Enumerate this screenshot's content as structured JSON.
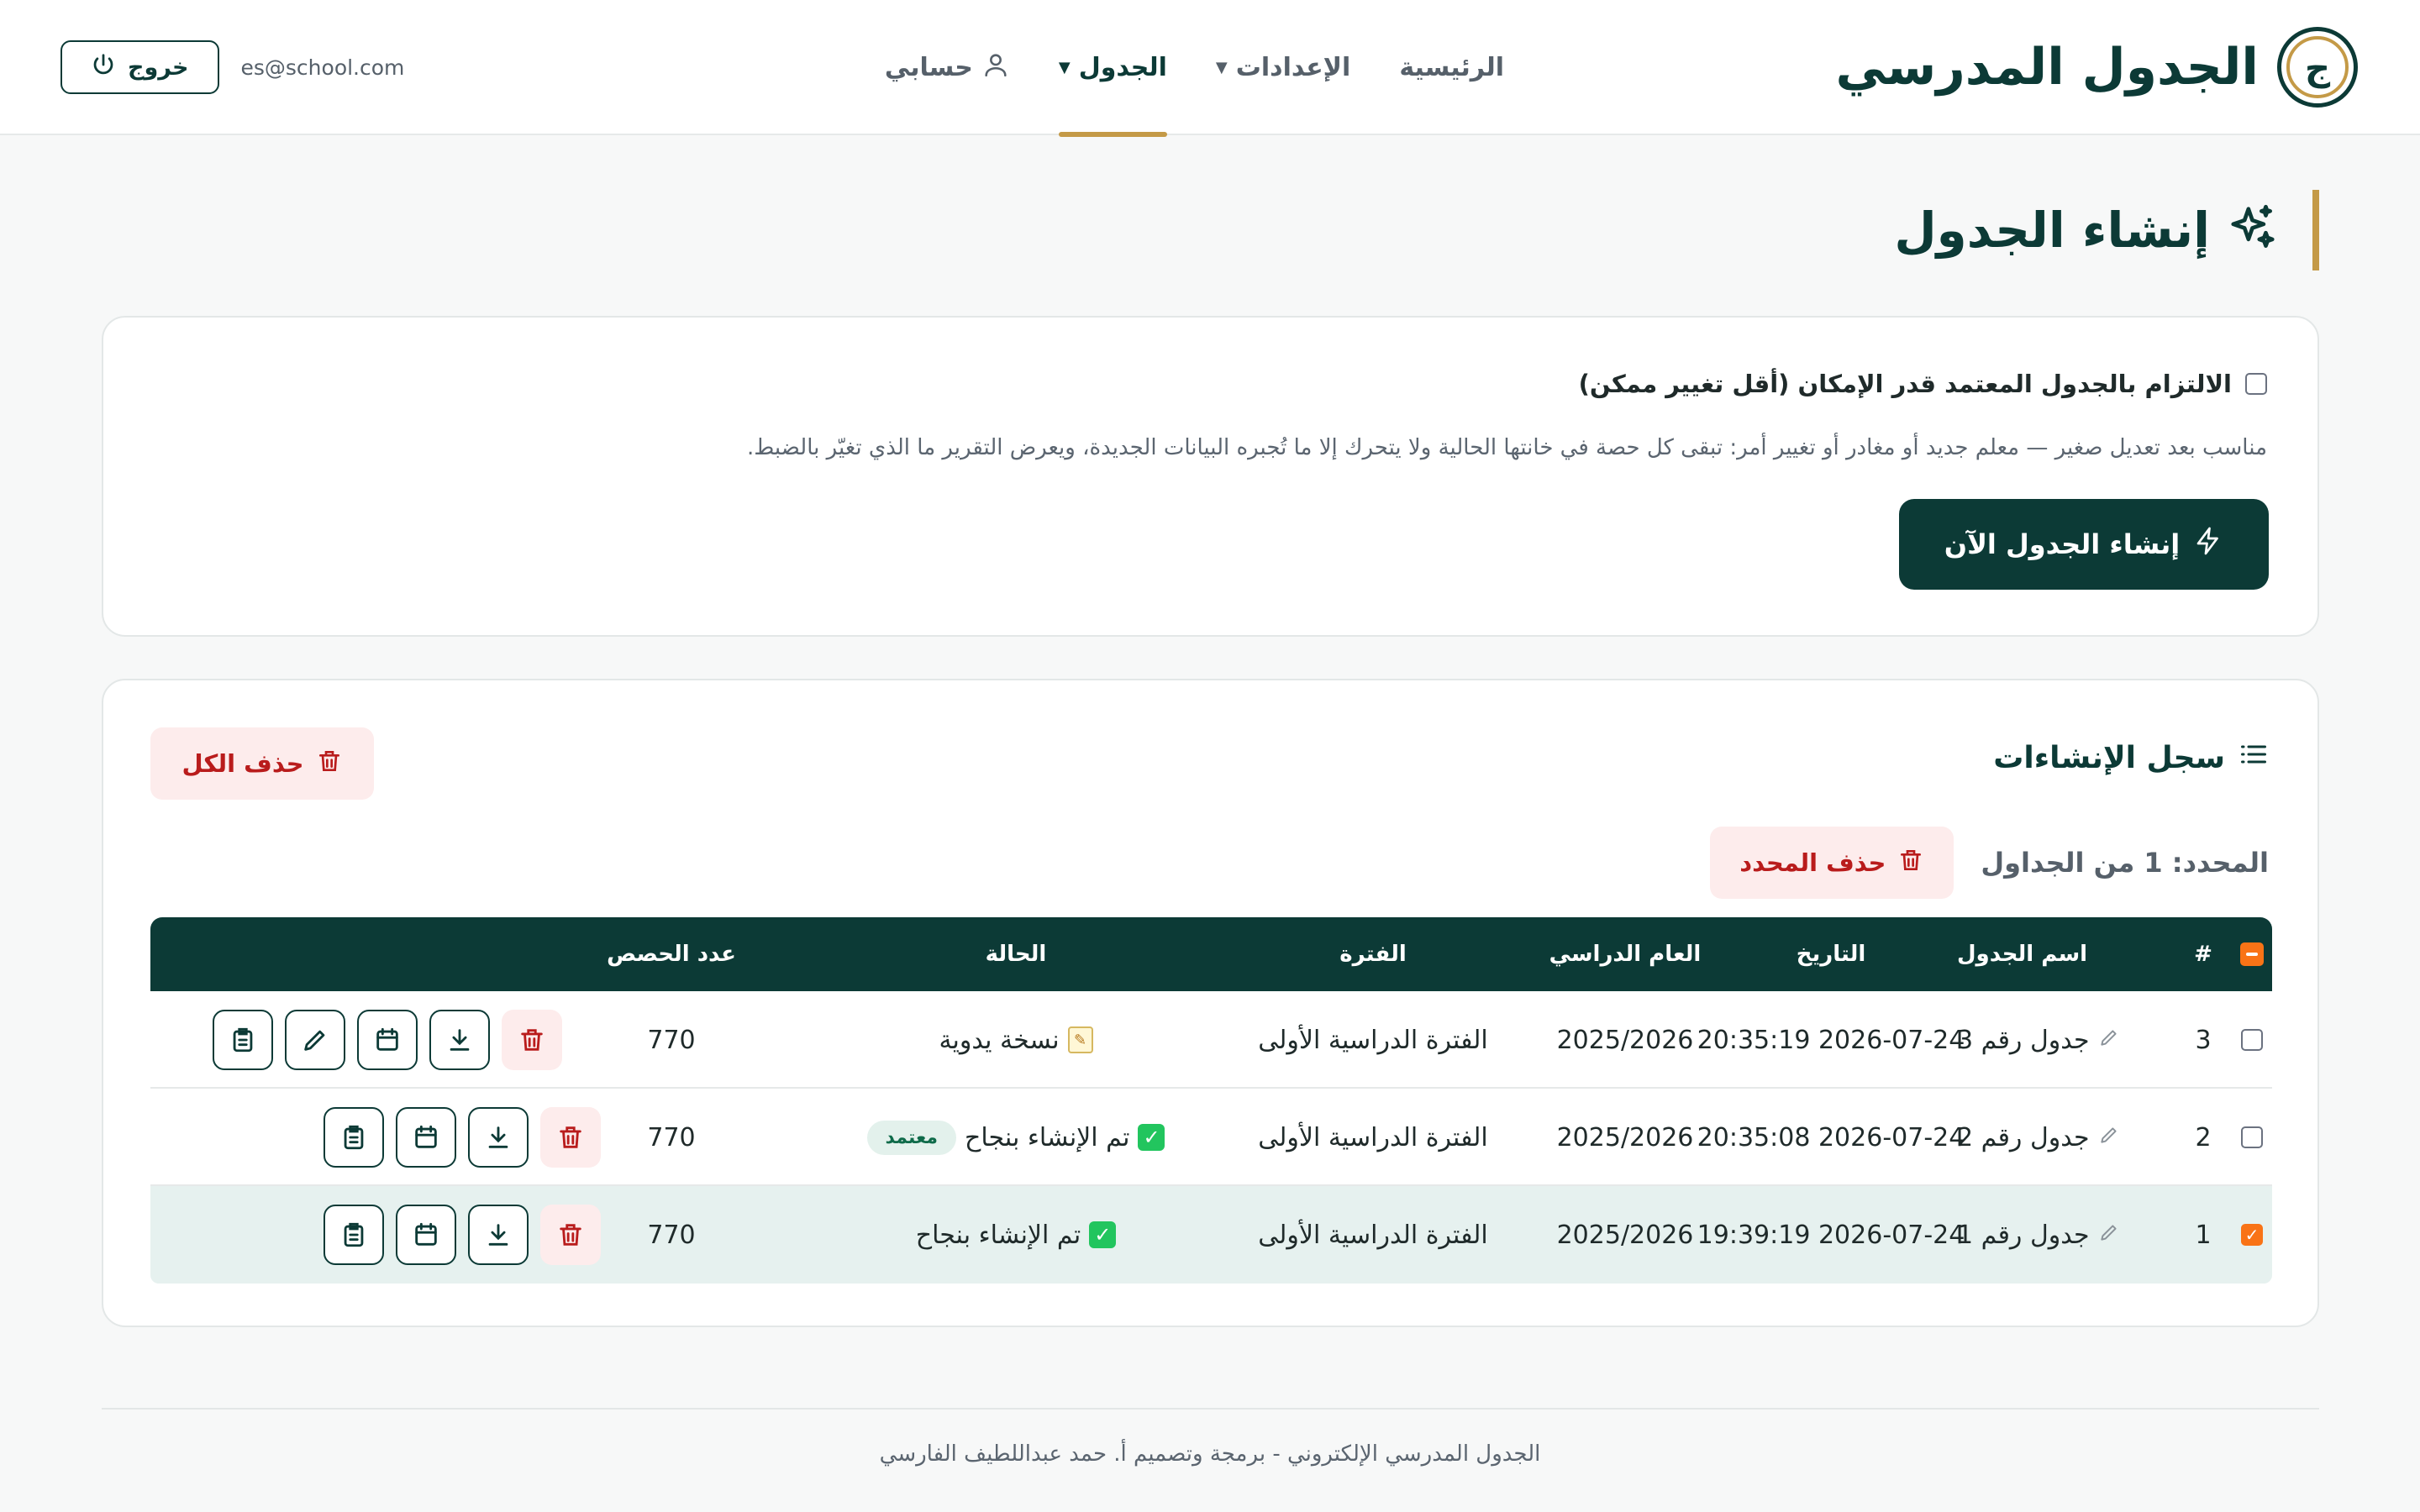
{
  "brand": {
    "logo_letter": "ج",
    "title": "الجدول المدرسي"
  },
  "nav": {
    "home": "الرئيسية",
    "settings": "الإعدادات",
    "schedule": "الجدول",
    "account": "حسابي"
  },
  "header": {
    "email": "es@school.com",
    "logout": "خروج"
  },
  "page": {
    "title": "إنشاء الجدول"
  },
  "generate": {
    "checkbox_label": "الالتزام بالجدول المعتمد قدر الإمكان (أقل تغيير ممكن)",
    "checkbox_checked": false,
    "description": "مناسب بعد تعديل صغير — معلم جديد أو مغادر أو تغيير أمر: تبقى كل حصة في خانتها الحالية ولا يتحرك إلا ما تُجبره البيانات الجديدة، ويعرض التقرير ما الذي تغيّر بالضبط.",
    "button": "إنشاء الجدول الآن"
  },
  "log": {
    "title": "سجل الإنشاءات",
    "delete_all": "حذف الكل",
    "selected_text": "المحدد: 1 من الجداول",
    "delete_selected": "حذف المحدد",
    "columns": {
      "num": "#",
      "name": "اسم الجدول",
      "date": "التاريخ",
      "year": "العام الدراسي",
      "period": "الفترة",
      "status": "الحالة",
      "count": "عدد الحصص"
    },
    "rows": [
      {
        "num": "3",
        "name": "جدول رقم 3",
        "date": "2026-07-24 20:35:19",
        "year": "2025/2026",
        "period": "الفترة الدراسية الأولى",
        "status": "نسخة يدوية",
        "badge": "",
        "count": "770",
        "checked": false
      },
      {
        "num": "2",
        "name": "جدول رقم 2",
        "date": "2026-07-24 20:35:08",
        "year": "2025/2026",
        "period": "الفترة الدراسية الأولى",
        "status": "تم الإنشاء بنجاح",
        "badge": "معتمد",
        "count": "770",
        "checked": false
      },
      {
        "num": "1",
        "name": "جدول رقم 1",
        "date": "2026-07-24 19:39:19",
        "year": "2025/2026",
        "period": "الفترة الدراسية الأولى",
        "status": "تم الإنشاء بنجاح",
        "badge": "",
        "count": "770",
        "checked": true
      }
    ]
  },
  "footer": {
    "text": "الجدول المدرسي الإلكتروني - برمجة وتصميم أ. حمد عبداللطيف الفارسي"
  },
  "colors": {
    "primary": "#0c3a36",
    "accent": "#c49a47",
    "danger": "#b91c1c",
    "check": "#f97316"
  }
}
